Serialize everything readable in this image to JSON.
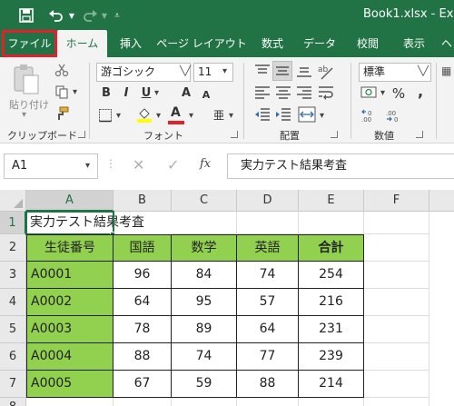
{
  "window": {
    "title": "Book1.xlsx - Ex"
  },
  "ribbon_tabs": [
    {
      "label": "ファイル"
    },
    {
      "label": "ホーム"
    },
    {
      "label": "挿入"
    },
    {
      "label": "ページ レイアウト"
    },
    {
      "label": "数式"
    },
    {
      "label": "データ"
    },
    {
      "label": "校閲"
    },
    {
      "label": "表示"
    },
    {
      "label": "ヘ"
    }
  ],
  "clipboard": {
    "paste_label": "貼り付け",
    "group_label": "クリップボード"
  },
  "font": {
    "name": "游ゴシック",
    "size": "11",
    "group_label": "フォント",
    "bold": "B",
    "italic": "I",
    "underline": "U",
    "font_color_letter": "A",
    "grow_letter": "A",
    "shrink_letter": "A",
    "phonetic": "亜",
    "highlight_color": "#ffff00",
    "font_color": "#e0202a"
  },
  "alignment": {
    "group_label": "配置"
  },
  "number": {
    "format": "標準",
    "group_label": "数値",
    "percent": "%",
    "comma": ","
  },
  "formula_bar": {
    "name_box": "A1",
    "fx_label": "fx",
    "content": "実力テスト結果考査"
  },
  "sheet": {
    "columns": [
      "A",
      "B",
      "C",
      "D",
      "E",
      "F"
    ],
    "rows": [
      "1",
      "2",
      "3",
      "4",
      "5",
      "6",
      "7",
      "8"
    ],
    "title_cell": "実力テスト結果考査",
    "headers": [
      "生徒番号",
      "国語",
      "数学",
      "英語",
      "合計"
    ],
    "data": [
      [
        "A0001",
        "96",
        "84",
        "74",
        "254"
      ],
      [
        "A0002",
        "64",
        "95",
        "57",
        "216"
      ],
      [
        "A0003",
        "78",
        "89",
        "64",
        "231"
      ],
      [
        "A0004",
        "88",
        "74",
        "77",
        "239"
      ],
      [
        "A0005",
        "67",
        "59",
        "88",
        "214"
      ]
    ],
    "header_fill": "#92d050"
  }
}
